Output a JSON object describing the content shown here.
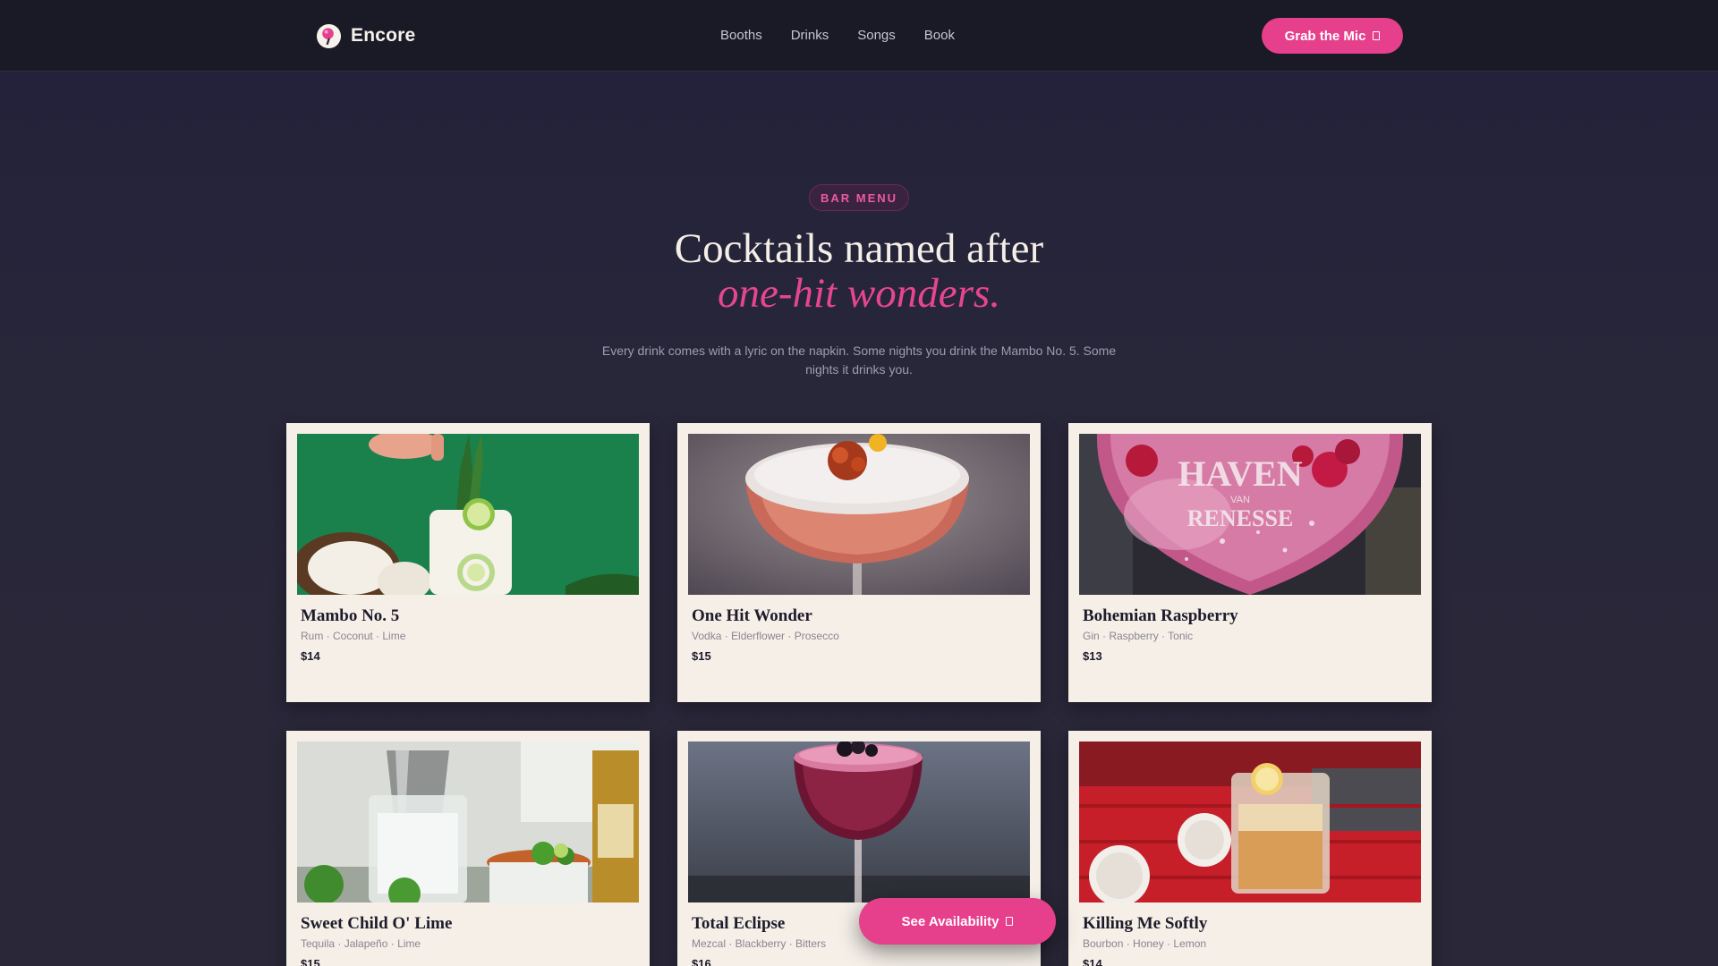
{
  "header": {
    "brand_name": "Encore",
    "nav": [
      "Booths",
      "Drinks",
      "Songs",
      "Book"
    ],
    "cta_label": "Grab the Mic",
    "cta_icon": "arrow-icon"
  },
  "hero": {
    "badge": "BAR MENU",
    "title": "Cocktails named after",
    "title_accent": "one-hit wonders.",
    "subtitle": "Every drink comes with a lyric on the napkin. Some nights you drink the Mambo No. 5. Some nights it drinks you."
  },
  "drinks": [
    {
      "name": "Mambo No. 5",
      "ingredients": "Rum · Coconut · Lime",
      "price": "$14"
    },
    {
      "name": "One Hit Wonder",
      "ingredients": "Vodka · Elderflower · Prosecco",
      "price": "$15"
    },
    {
      "name": "Bohemian Raspberry",
      "ingredients": "Gin · Raspberry · Tonic",
      "price": "$13"
    },
    {
      "name": "Sweet Child O' Lime",
      "ingredients": "Tequila · Jalapeño · Lime",
      "price": "$15"
    },
    {
      "name": "Total Eclipse",
      "ingredients": "Mezcal · Blackberry · Bitters",
      "price": "$16"
    },
    {
      "name": "Killing Me Softly",
      "ingredients": "Bourbon · Honey · Lemon",
      "price": "$14"
    }
  ],
  "photo_text": {
    "glass_brand": "HAVEN",
    "glass_small": "VAN",
    "glass_sub": "RENESSE"
  },
  "floating_cta": {
    "label": "See Availability",
    "icon": "arrow-icon"
  },
  "colors": {
    "accent": "#e63f8c",
    "header_bg": "#1a1a26",
    "page_bg": "#282639",
    "card_bg": "#f5efe8"
  }
}
